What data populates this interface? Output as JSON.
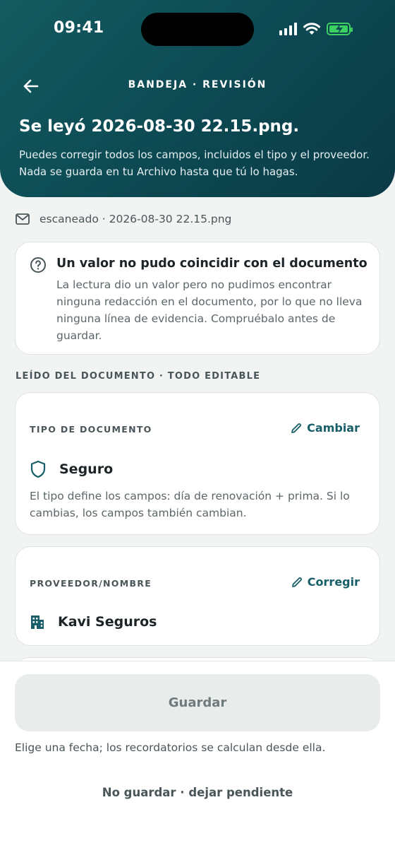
{
  "status_bar": {
    "time": "09:41"
  },
  "header": {
    "breadcrumb": "BANDEJA · REVISIÓN",
    "title": "Se leyó 2026-08-30 22.15.png.",
    "description": "Puedes corregir todos los campos, incluidos el tipo y el proveedor. Nada se guarda en tu Archivo hasta que tú lo hagas."
  },
  "source": {
    "text": "escaneado · 2026-08-30 22.15.png",
    "icon": "mail-icon"
  },
  "notice": {
    "icon": "question-circle-icon",
    "title": "Un valor no pudo coincidir con el documento",
    "body": "La lectura dio un valor pero no pudimos encontrar ninguna redacción en el documento, por lo que no lleva ninguna línea de evidencia. Compruébalo antes de guardar."
  },
  "section_label": "LEÍDO DEL DOCUMENTO · TODO EDITABLE",
  "fields": {
    "type": {
      "label": "TIPO DE DOCUMENTO",
      "action": "Cambiar",
      "value": "Seguro",
      "icon": "shield-icon",
      "hint": "El tipo define los campos: día de renovación + prima. Si lo cambias, los campos también cambian."
    },
    "provider": {
      "label": "PROVEEDOR/NOMBRE",
      "action": "Corregir",
      "value": "Kavi Seguros",
      "icon": "building-icon"
    }
  },
  "footer": {
    "save_label": "Guardar",
    "hint": "Elige una fecha; los recordatorios se calculan desde ella.",
    "skip_label": "No guardar · dejar pendiente"
  },
  "colors": {
    "header_bg": "#0d4a53",
    "accent": "#175e68",
    "battery": "#3ccf62",
    "disabled_button": "#e8ecea"
  }
}
